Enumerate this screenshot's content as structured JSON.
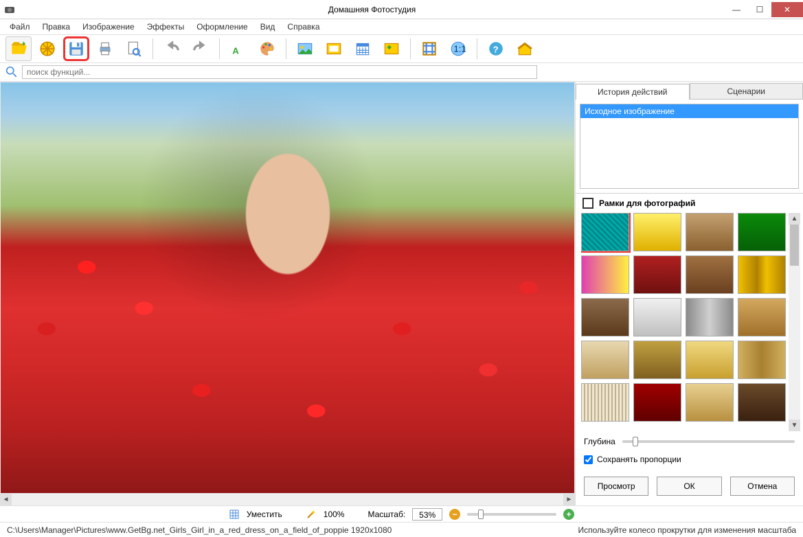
{
  "title": "Домашняя Фотостудия",
  "menu": [
    "Файл",
    "Правка",
    "Изображение",
    "Эффекты",
    "Оформление",
    "Вид",
    "Справка"
  ],
  "search": {
    "placeholder": "поиск функций..."
  },
  "tabs": {
    "history": "История действий",
    "scripts": "Сценарии"
  },
  "history": {
    "items": [
      "Исходное изображение"
    ]
  },
  "frames_panel": {
    "title": "Рамки для фотографий",
    "depth_label": "Глубина",
    "keep_ratio": "Сохранять пропорции",
    "keep_ratio_checked": true,
    "buttons": {
      "preview": "Просмотр",
      "ok": "ОК",
      "cancel": "Отмена"
    },
    "thumbs": [
      "linear-gradient(45deg,#0aa 25%,#088 25%,#088 50%,#0aa 50%,#0aa 75%,#088 75%)",
      "linear-gradient(to bottom,#fff06a,#e0b000)",
      "linear-gradient(to bottom,#c4a070,#8a6030)",
      "linear-gradient(to bottom,#0a8a0a,#066006)",
      "linear-gradient(to right,#e040b0,#fff040)",
      "linear-gradient(to bottom,#b02020,#701010)",
      "linear-gradient(to bottom,#a07040,#6a4020)",
      "linear-gradient(to right,#f0c000,#b08000 40%,#f0c000 60%,#b08000)",
      "linear-gradient(to bottom,#8a6a4a,#5a3a1a)",
      "linear-gradient(to bottom,#f0f0f0,#c0c0c0)",
      "linear-gradient(to right,#8a8a8a,#d0d0d0,#8a8a8a)",
      "linear-gradient(to bottom,#d4a860,#a0702a)",
      "linear-gradient(to bottom,#e8d8b0,#c0a060)",
      "linear-gradient(to bottom,#c0a040,#806020)",
      "linear-gradient(to bottom,#f0d880,#c8a030)",
      "linear-gradient(to right,#d0b060,#a88030,#d0b060)",
      "repeating-linear-gradient(90deg,#f0e8d0,#f0e8d0 3px,#c0b090 3px,#c0b090 5px)",
      "linear-gradient(to bottom,#a00000,#600000)",
      "linear-gradient(to bottom,#e8d090,#b89040)",
      "linear-gradient(to bottom,#6a4a2a,#3a2010)"
    ]
  },
  "zoom": {
    "fit_label": "Уместить",
    "hundred_label": "100%",
    "scale_label": "Масштаб:",
    "value": "53%"
  },
  "status": {
    "path": "C:\\Users\\Manager\\Pictures\\www.GetBg.net_Girls_Girl_in_a_red_dress_on_a_field_of_poppie 1920x1080",
    "hint": "Используйте колесо прокрутки для изменения масштаба"
  }
}
